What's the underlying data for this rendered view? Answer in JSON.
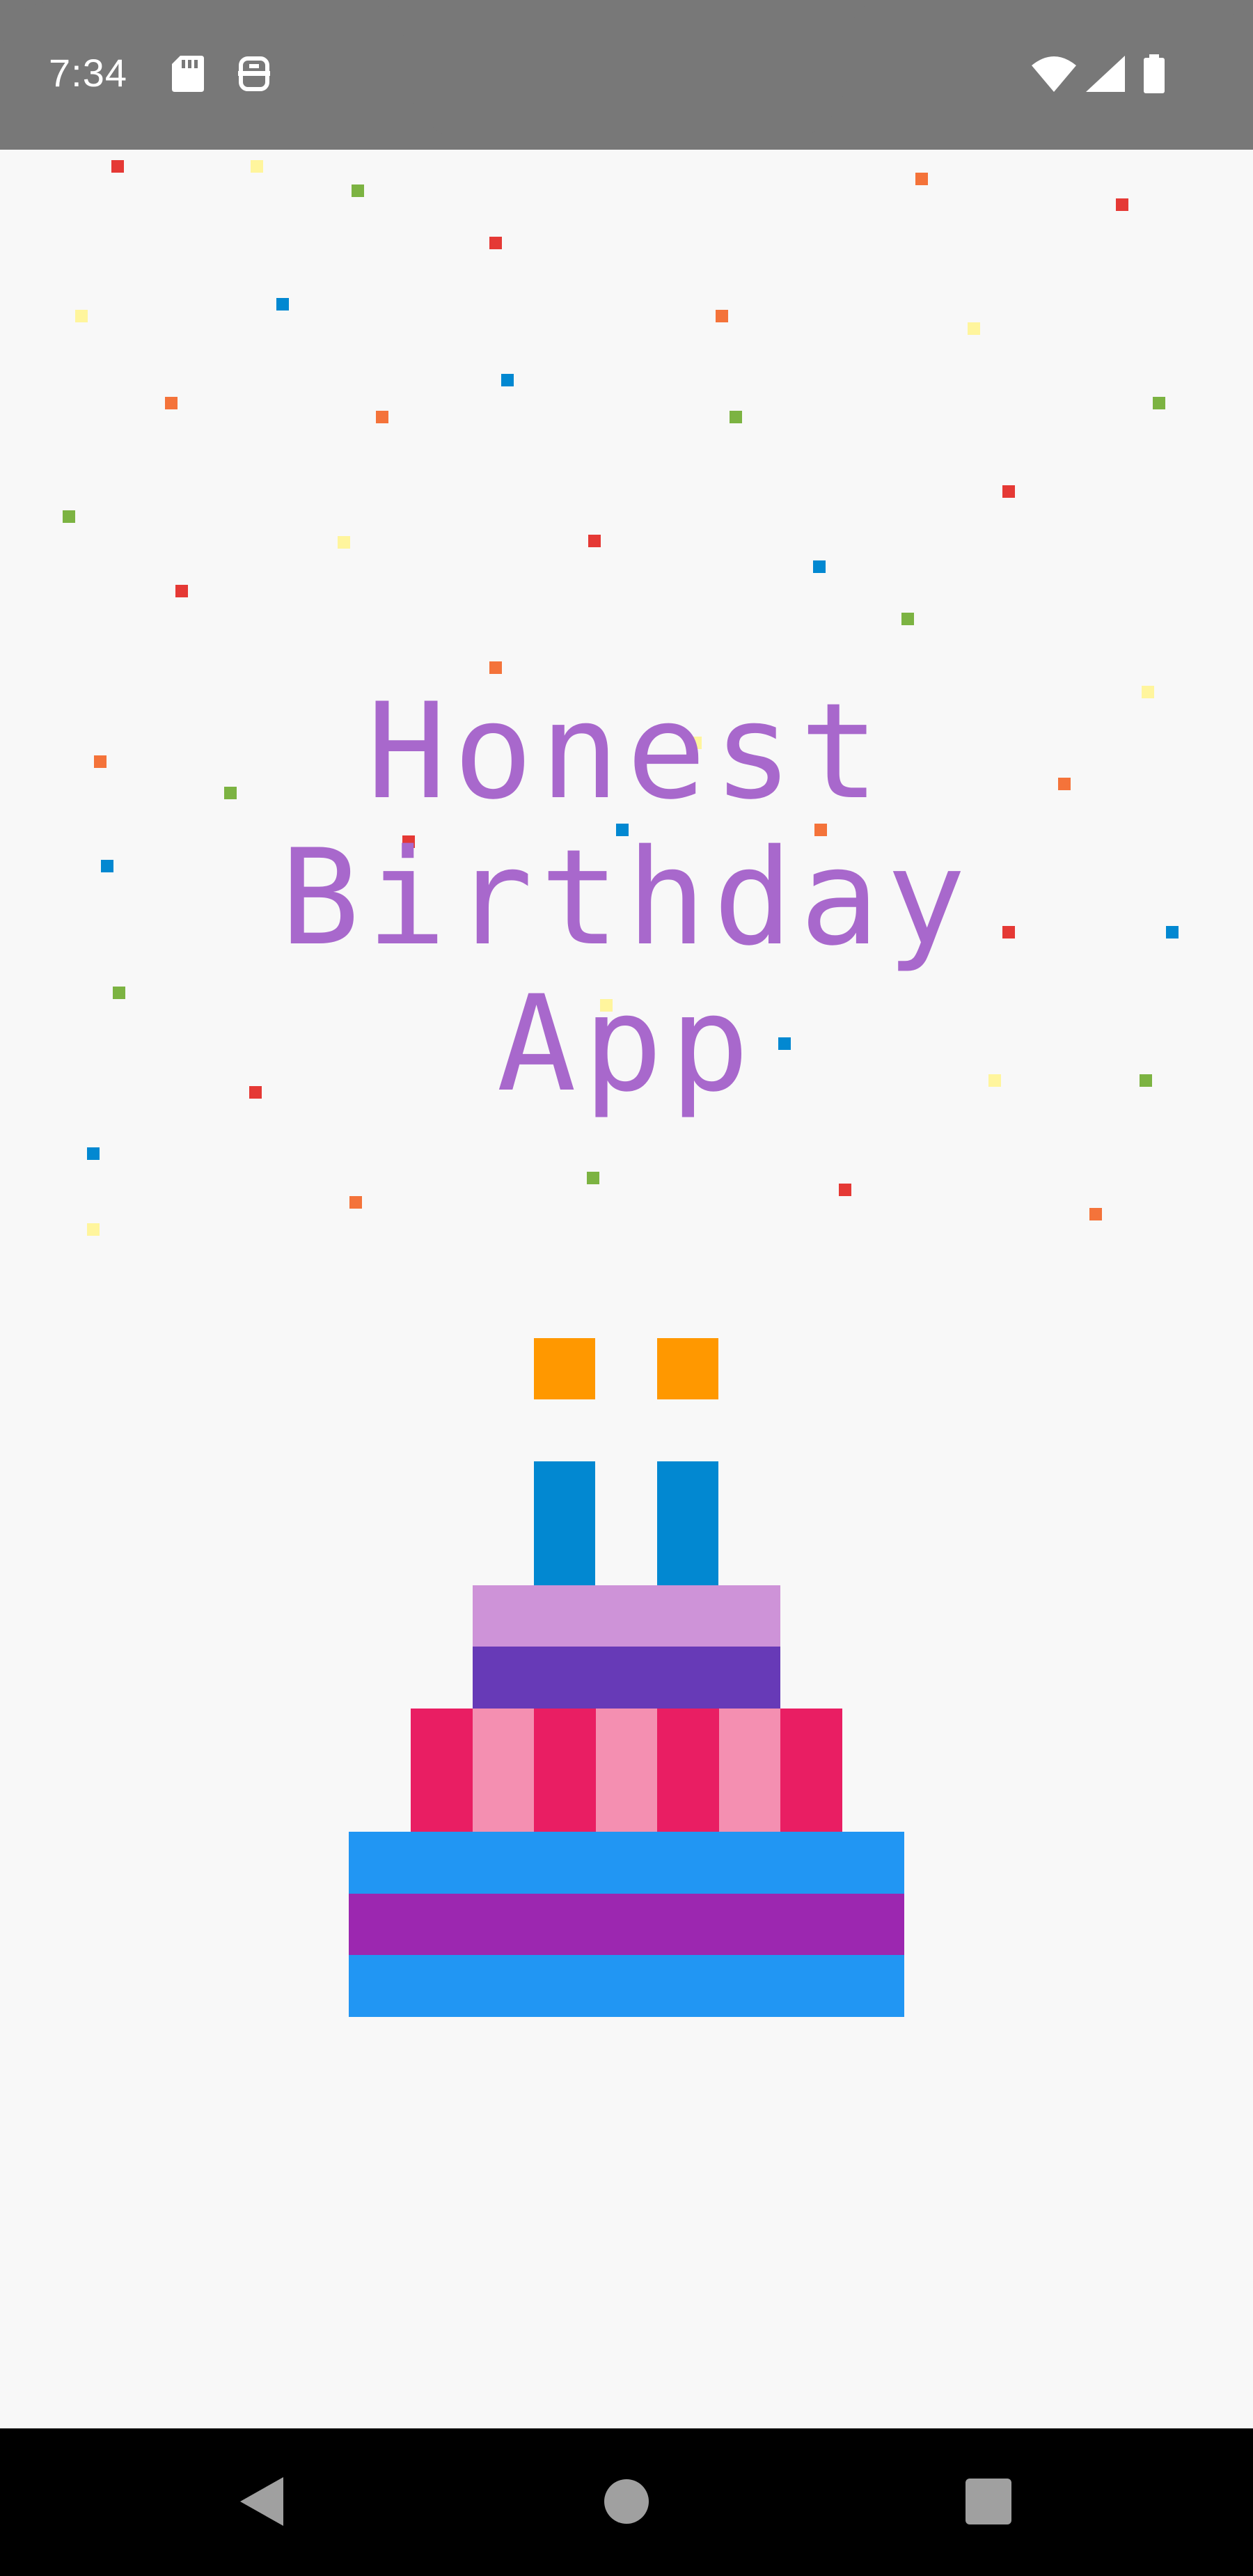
{
  "status_bar": {
    "time": "7:34",
    "icons": [
      "sd-card-icon",
      "notification-icon",
      "wifi-icon",
      "signal-icon",
      "battery-icon"
    ]
  },
  "app": {
    "title_line1": "Honest Birthday",
    "title_line2": "App",
    "title_color": "#a868cc"
  },
  "confetti_colors": [
    "#e53935",
    "#fff59d",
    "#7cb342",
    "#0288d1",
    "#f4733a"
  ],
  "cake_colors": {
    "flame": "#ff9800",
    "candle": "#0288d1",
    "top_tier_light": "#ce93d8",
    "top_tier_dark": "#673ab7",
    "middle_pink_dark": "#e91e63",
    "middle_pink_light": "#f48fb1",
    "bottom_blue": "#2196f3",
    "bottom_purple": "#9c27b0"
  },
  "nav_bar": {
    "buttons": [
      "back-button",
      "home-button",
      "recents-button"
    ]
  }
}
